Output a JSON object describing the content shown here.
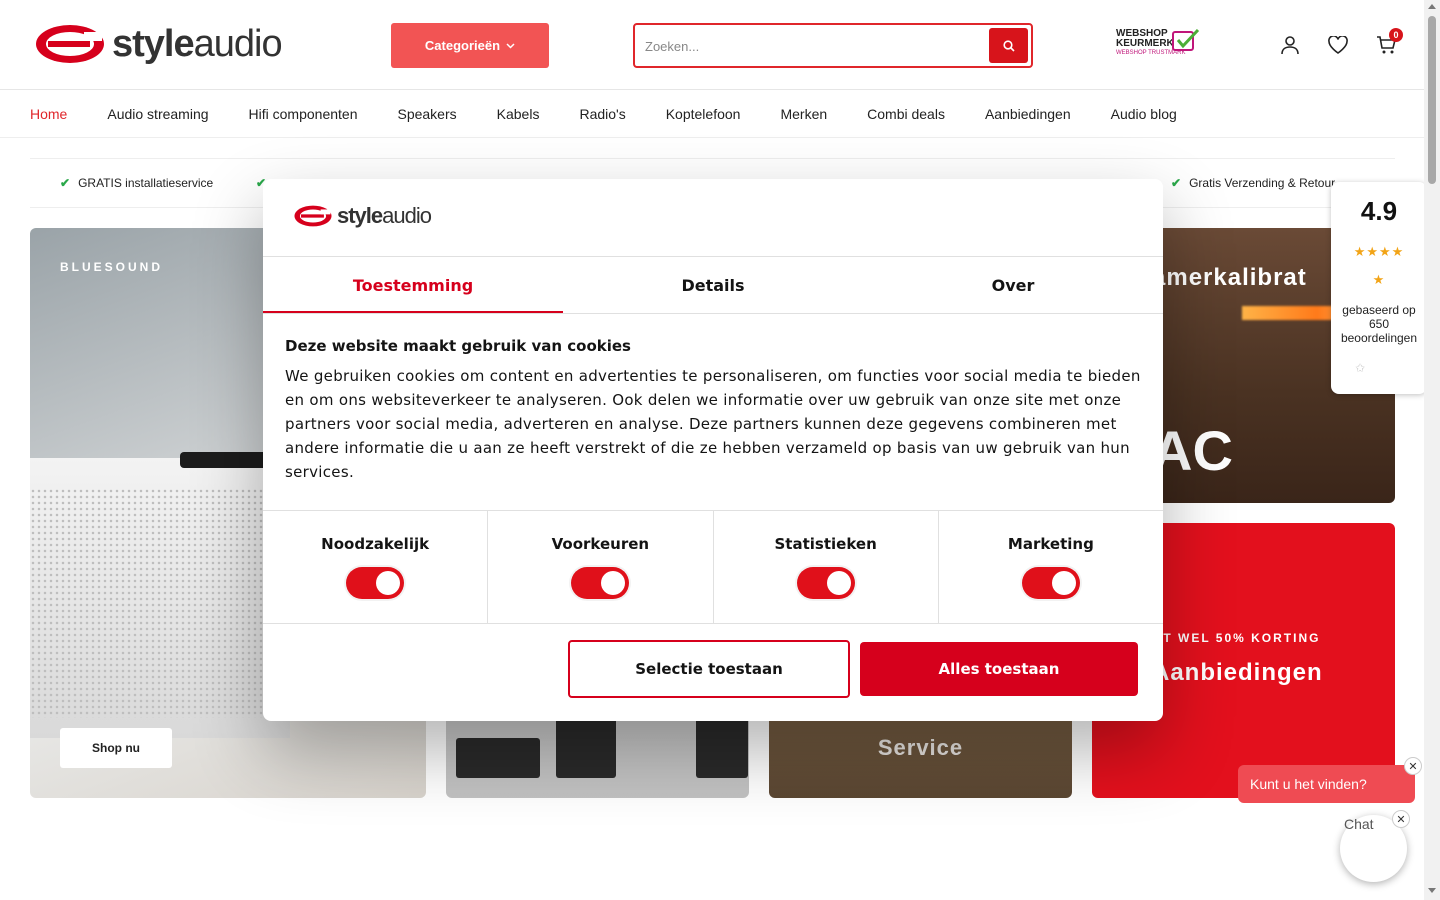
{
  "header": {
    "logo_bold": "style",
    "logo_light": "audio",
    "categories_label": "Categorieën",
    "search": {
      "placeholder": "Zoeken...",
      "value": ""
    },
    "keurmerk": {
      "line1": "WEBSHOP",
      "line2": "KEURMERK",
      "line3": "WEBSHOP TRUSTMARK"
    },
    "cart_count": "0",
    "icons": [
      "user-icon",
      "heart-icon",
      "cart-icon",
      "search-icon",
      "chevron-down-icon"
    ]
  },
  "nav": {
    "items": [
      "Home",
      "Audio streaming",
      "Hifi componenten",
      "Speakers",
      "Kabels",
      "Radio's",
      "Koptelefoon",
      "Merken",
      "Combi deals",
      "Aanbiedingen",
      "Audio blog"
    ],
    "active": "Home"
  },
  "usp": {
    "items": [
      "GRATIS installatieservice",
      "Gratis Verzending & Retour"
    ]
  },
  "hero": {
    "main_brand": "BLUESOUND",
    "main_button": "Shop nu",
    "tile_service_lines": [
      "Service"
    ],
    "tile_kalibratie_title": "amerkalibrat",
    "tile_kalibratie_big": "AC",
    "tile_deals_kicker": "OT WEL 50% KORTING",
    "tile_deals_title": "Aanbiedingen"
  },
  "rating": {
    "score": "4.9",
    "stars": "★★★★",
    "half_star": "★",
    "based_on": "gebaseerd op 650 beoordelingen"
  },
  "chat": {
    "bubble_text": "Kunt u het vinden?",
    "alt_text": "Chat",
    "close_glyph": "✕"
  },
  "cookie_modal": {
    "logo_bold": "style",
    "logo_light": "audio",
    "tabs": [
      {
        "label": "Toestemming",
        "active": true
      },
      {
        "label": "Details",
        "active": false
      },
      {
        "label": "Over",
        "active": false
      }
    ],
    "title": "Deze website maakt gebruik van cookies",
    "body": "We gebruiken cookies om content en advertenties te personaliseren, om functies voor social media te bieden en om ons websiteverkeer te analyseren. Ook delen we informatie over uw gebruik van onze site met onze partners voor social media, adverteren en analyse. Deze partners kunnen deze gegevens combineren met andere informatie die u aan ze heeft verstrekt of die ze hebben verzameld op basis van uw gebruik van hun services.",
    "toggles": [
      {
        "label": "Noodzakelijk",
        "checked": true
      },
      {
        "label": "Voorkeuren",
        "checked": true
      },
      {
        "label": "Statistieken",
        "checked": true
      },
      {
        "label": "Marketing",
        "checked": true
      }
    ],
    "btn_selection": "Selectie toestaan",
    "btn_all": "Alles toestaan"
  },
  "colors": {
    "brand_red": "#d6001c",
    "category_button": "#f25454",
    "usp_check": "#2aa84a",
    "star": "#f2a417",
    "chat_bubble": "#ef4b53"
  }
}
